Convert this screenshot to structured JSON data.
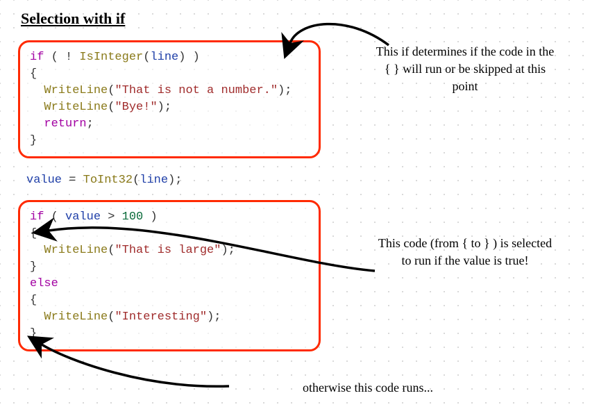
{
  "title": "Selection with if",
  "code_box1": [
    [
      {
        "cls": "kw",
        "t": "if"
      },
      {
        "cls": "pn",
        "t": " ( ! "
      },
      {
        "cls": "fn",
        "t": "IsInteger"
      },
      {
        "cls": "pn",
        "t": "("
      },
      {
        "cls": "var",
        "t": "line"
      },
      {
        "cls": "pn",
        "t": ") )"
      }
    ],
    [
      {
        "cls": "pn",
        "t": "{"
      }
    ],
    [
      {
        "cls": "pn",
        "t": "  "
      },
      {
        "cls": "fn",
        "t": "WriteLine"
      },
      {
        "cls": "pn",
        "t": "("
      },
      {
        "cls": "str",
        "t": "\"That is not a number.\""
      },
      {
        "cls": "pn",
        "t": ");"
      }
    ],
    [
      {
        "cls": "pn",
        "t": "  "
      },
      {
        "cls": "fn",
        "t": "WriteLine"
      },
      {
        "cls": "pn",
        "t": "("
      },
      {
        "cls": "str",
        "t": "\"Bye!\""
      },
      {
        "cls": "pn",
        "t": ");"
      }
    ],
    [
      {
        "cls": "pn",
        "t": "  "
      },
      {
        "cls": "kw",
        "t": "return"
      },
      {
        "cls": "pn",
        "t": ";"
      }
    ],
    [
      {
        "cls": "pn",
        "t": "}"
      }
    ]
  ],
  "free_code": [
    [
      {
        "cls": "var",
        "t": "value"
      },
      {
        "cls": "pn",
        "t": " = "
      },
      {
        "cls": "fn",
        "t": "ToInt32"
      },
      {
        "cls": "pn",
        "t": "("
      },
      {
        "cls": "var",
        "t": "line"
      },
      {
        "cls": "pn",
        "t": ");"
      }
    ]
  ],
  "code_box2": [
    [
      {
        "cls": "kw",
        "t": "if"
      },
      {
        "cls": "pn",
        "t": " ( "
      },
      {
        "cls": "var",
        "t": "value"
      },
      {
        "cls": "pn",
        "t": " > "
      },
      {
        "cls": "num",
        "t": "100"
      },
      {
        "cls": "pn",
        "t": " )"
      }
    ],
    [
      {
        "cls": "pn",
        "t": "{"
      }
    ],
    [
      {
        "cls": "pn",
        "t": "  "
      },
      {
        "cls": "fn",
        "t": "WriteLine"
      },
      {
        "cls": "pn",
        "t": "("
      },
      {
        "cls": "str",
        "t": "\"That is large\""
      },
      {
        "cls": "pn",
        "t": ");"
      }
    ],
    [
      {
        "cls": "pn",
        "t": "}"
      }
    ],
    [
      {
        "cls": "kw",
        "t": "else"
      }
    ],
    [
      {
        "cls": "pn",
        "t": "{"
      }
    ],
    [
      {
        "cls": "pn",
        "t": "  "
      },
      {
        "cls": "fn",
        "t": "WriteLine"
      },
      {
        "cls": "pn",
        "t": "("
      },
      {
        "cls": "str",
        "t": "\"Interesting\""
      },
      {
        "cls": "pn",
        "t": ");"
      }
    ],
    [
      {
        "cls": "pn",
        "t": "}"
      }
    ]
  ],
  "note1": "This if determines if the code in the { } will run or be skipped at this point",
  "note2": "This code (from { to } ) is selected to run if the value is true!",
  "note3": "otherwise this code runs..."
}
